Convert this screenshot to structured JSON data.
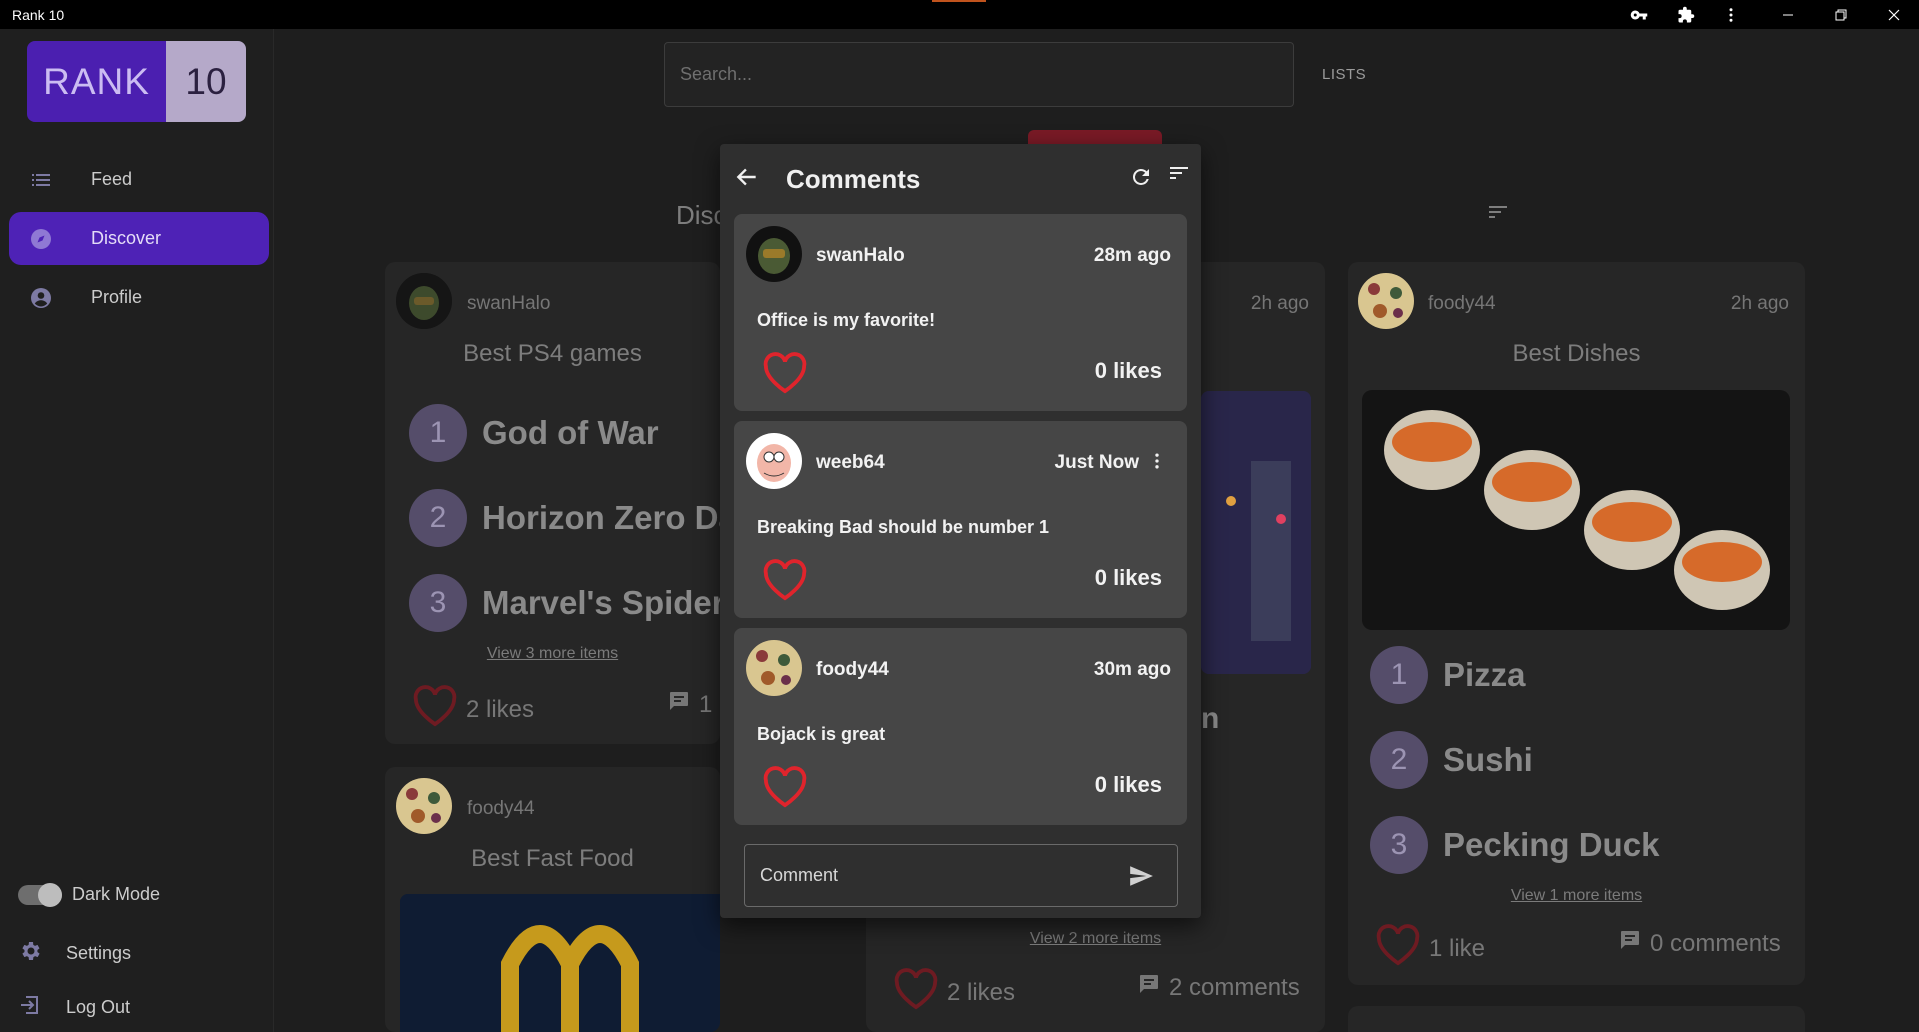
{
  "window": {
    "title": "Rank 10"
  },
  "logo": {
    "left": "RANK",
    "right": "10"
  },
  "sidebar": {
    "items": [
      {
        "label": "Feed",
        "icon": "list-icon"
      },
      {
        "label": "Discover",
        "icon": "compass-icon"
      },
      {
        "label": "Profile",
        "icon": "account-icon"
      }
    ],
    "dark_mode_label": "Dark Mode",
    "settings_label": "Settings",
    "logout_label": "Log Out"
  },
  "search": {
    "placeholder": "Search..."
  },
  "nav": {
    "lists_label": "LISTS"
  },
  "discover": {
    "heading": "Disc"
  },
  "cards": {
    "c1": {
      "user": "swanHalo",
      "title": "Best PS4 games",
      "items": [
        {
          "rank": "1",
          "name": "God of War"
        },
        {
          "rank": "2",
          "name": "Horizon Zero Da"
        },
        {
          "rank": "3",
          "name": "Marvel's Spider-"
        }
      ],
      "more": "View 3 more items",
      "likes": "2 likes",
      "comments": "1"
    },
    "c2": {
      "user": "foody44",
      "title": "Best Fast Food"
    },
    "c3": {
      "ago": "2h ago",
      "partial_text": "n",
      "more": "View 2 more items",
      "likes": "2 likes",
      "comments": "2 comments"
    },
    "c4": {
      "user": "foody44",
      "ago": "2h ago",
      "title": "Best Dishes",
      "items": [
        {
          "rank": "1",
          "name": "Pizza"
        },
        {
          "rank": "2",
          "name": "Sushi"
        },
        {
          "rank": "3",
          "name": "Pecking Duck"
        }
      ],
      "more": "View 1 more items",
      "likes": "1 like",
      "comments": "0 comments"
    }
  },
  "modal": {
    "title": "Comments",
    "comments": [
      {
        "user": "swanHalo",
        "time": "28m ago",
        "text": "Office is my favorite!",
        "likes": "0 likes"
      },
      {
        "user": "weeb64",
        "time": "Just Now",
        "text": "Breaking Bad should be number 1",
        "likes": "0 likes"
      },
      {
        "user": "foody44",
        "time": "30m ago",
        "text": "Bojack is great",
        "likes": "0 likes"
      }
    ],
    "input_placeholder": "Comment"
  },
  "colors": {
    "accent": "#4e22b6",
    "heart": "#e0242c",
    "logo_left": "#4b1fb0",
    "logo_right": "#b5a9c9"
  }
}
